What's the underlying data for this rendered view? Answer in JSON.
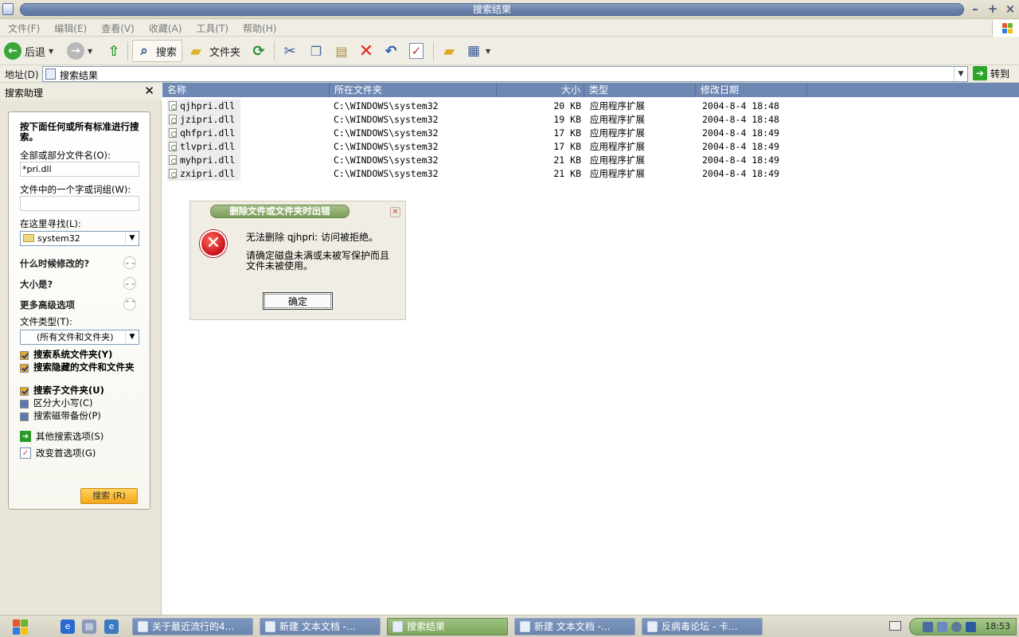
{
  "window": {
    "title": "搜索结果"
  },
  "menu": [
    "文件(F)",
    "编辑(E)",
    "查看(V)",
    "收藏(A)",
    "工具(T)",
    "帮助(H)"
  ],
  "toolbar": {
    "back": "后退",
    "search": "搜索",
    "folders": "文件夹"
  },
  "address": {
    "label": "地址(D)",
    "value": "搜索结果",
    "go": "转到"
  },
  "assistant": {
    "title": "搜索助理",
    "heading": "按下面任何或所有标准进行搜索。",
    "filename_label": "全部或部分文件名(O):",
    "filename_value": "*pri.dll",
    "phrase_label": "文件中的一个字或词组(W):",
    "phrase_value": "",
    "lookin_label": "在这里寻找(L):",
    "lookin_value": "system32",
    "when_modified": "什么时候修改的?",
    "size": "大小是?",
    "advanced": "更多高级选项",
    "filetype_label": "文件类型(T):",
    "filetype_value": "(所有文件和文件夹)",
    "options": [
      {
        "label": "搜索系统文件夹(Y)",
        "checked": true
      },
      {
        "label": "搜索隐藏的文件和文件夹",
        "checked": true
      },
      {
        "label": "搜索子文件夹(U)",
        "checked": true
      },
      {
        "label": "区分大小写(C)",
        "checked": false
      },
      {
        "label": "搜索磁带备份(P)",
        "checked": false
      }
    ],
    "other_options": "其他搜索选项(S)",
    "change_prefs": "改变首选项(G)",
    "search_button": "搜索 (R)"
  },
  "columns": [
    "名称",
    "所在文件夹",
    "大小",
    "类型",
    "修改日期"
  ],
  "files": [
    {
      "name": "qjhpri.dll",
      "folder": "C:\\WINDOWS\\system32",
      "size": "20 KB",
      "type": "应用程序扩展",
      "modified": "2004-8-4 18:48"
    },
    {
      "name": "jzipri.dll",
      "folder": "C:\\WINDOWS\\system32",
      "size": "19 KB",
      "type": "应用程序扩展",
      "modified": "2004-8-4 18:48"
    },
    {
      "name": "qhfpri.dll",
      "folder": "C:\\WINDOWS\\system32",
      "size": "17 KB",
      "type": "应用程序扩展",
      "modified": "2004-8-4 18:49"
    },
    {
      "name": "tlvpri.dll",
      "folder": "C:\\WINDOWS\\system32",
      "size": "17 KB",
      "type": "应用程序扩展",
      "modified": "2004-8-4 18:49"
    },
    {
      "name": "myhpri.dll",
      "folder": "C:\\WINDOWS\\system32",
      "size": "21 KB",
      "type": "应用程序扩展",
      "modified": "2004-8-4 18:49"
    },
    {
      "name": "zxipri.dll",
      "folder": "C:\\WINDOWS\\system32",
      "size": "21 KB",
      "type": "应用程序扩展",
      "modified": "2004-8-4 18:49"
    }
  ],
  "dialog": {
    "title": "删除文件或文件夹时出错",
    "message": "无法删除 qjhpri: 访问被拒绝。",
    "detail": "请确定磁盘未满或未被写保护而且文件未被使用。",
    "ok": "确定"
  },
  "taskbar": {
    "tasks": [
      {
        "label": "关于最近流行的4..."
      },
      {
        "label": "新建 文本文档 -..."
      },
      {
        "label": "搜索结果",
        "active": true
      },
      {
        "label": "新建 文本文档 -..."
      },
      {
        "label": "反病毒论坛 - 卡..."
      }
    ],
    "clock": "18:53"
  }
}
